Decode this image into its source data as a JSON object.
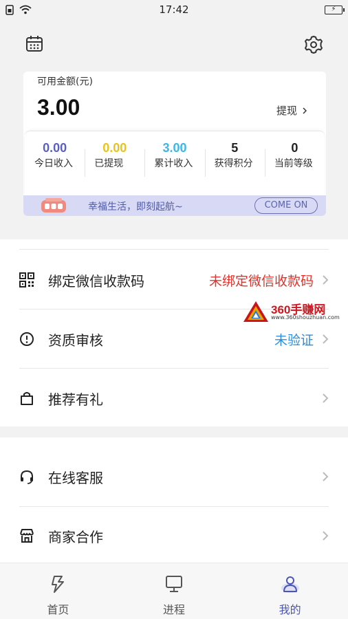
{
  "status_bar": {
    "time": "17:42",
    "battery_glyph": "⚡"
  },
  "card": {
    "balance_label": "可用金额(元)",
    "balance_value": "3.00",
    "withdraw_label": "提现",
    "stats": [
      {
        "value": "0.00",
        "label": "今日收入",
        "color": "#5a5fc2"
      },
      {
        "value": "0.00",
        "label": "已提现",
        "color": "#e8c41a"
      },
      {
        "value": "3.00",
        "label": "累计收入",
        "color": "#3bb7e6"
      },
      {
        "value": "5",
        "label": "获得积分",
        "color": "#222222"
      },
      {
        "value": "0",
        "label": "当前等级",
        "color": "#222222"
      }
    ],
    "banner_text": "幸福生活，即刻起航~",
    "banner_button": "COME ON"
  },
  "menu": {
    "bind_wechat": {
      "label": "绑定微信收款码",
      "status": "未绑定微信收款码",
      "status_color": "#e0322b"
    },
    "qualification": {
      "label": "资质审核",
      "status": "未验证",
      "status_color": "#2a8ee0"
    },
    "referral": {
      "label": "推荐有礼"
    },
    "support": {
      "label": "在线客服"
    },
    "merchant": {
      "label": "商家合作"
    }
  },
  "watermark": {
    "title": "360手赚网",
    "url": "www.360shouzhuan.com"
  },
  "tabs": [
    {
      "label": "首页",
      "icon": "lightning-icon"
    },
    {
      "label": "进程",
      "icon": "monitor-icon"
    },
    {
      "label": "我的",
      "icon": "user-icon",
      "active": true
    }
  ],
  "colors": {
    "accent": "#4b55b5"
  }
}
